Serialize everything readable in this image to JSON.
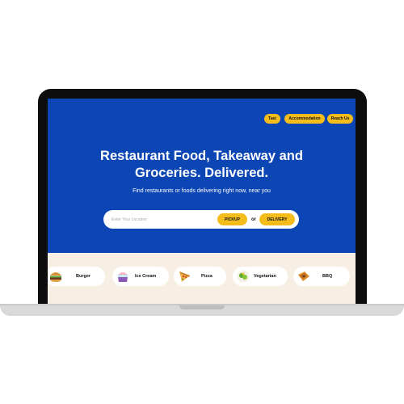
{
  "nav": {
    "taxi": "Taxi",
    "accommodation": "Accommodation",
    "reach_us": "Reach Us"
  },
  "hero": {
    "headline_line1": "Restaurant Food, Takeaway and",
    "headline_line2": "Groceries. Delivered.",
    "subtitle": "Find restaurants or foods delivering right now, near you"
  },
  "search": {
    "placeholder": "Enter Your Location",
    "pickup_label": "PICKUP",
    "or_label": "or",
    "delivery_label": "DELIVERY"
  },
  "categories": [
    {
      "label": "Burger",
      "icon": "burger-icon"
    },
    {
      "label": "Ice Cream",
      "icon": "ice-cream-icon"
    },
    {
      "label": "Pizza",
      "icon": "pizza-icon"
    },
    {
      "label": "Vegetarian",
      "icon": "vegetarian-icon"
    },
    {
      "label": "BBQ",
      "icon": "bbq-icon"
    }
  ],
  "colors": {
    "hero_blue": "#0c45b4",
    "accent_yellow": "#f4bd1c",
    "strip_bg": "#f7efe3"
  }
}
